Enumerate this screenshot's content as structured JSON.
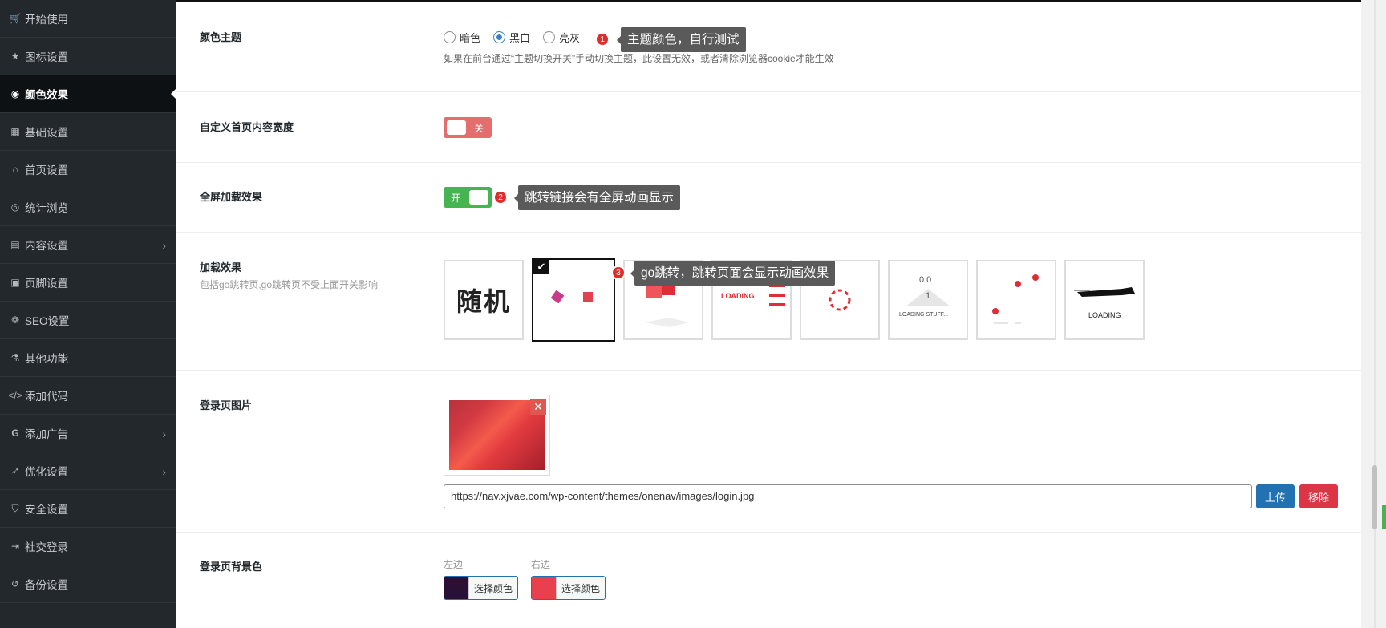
{
  "sidebar": {
    "items": [
      {
        "label": "开始使用",
        "icon": "cart-icon"
      },
      {
        "label": "图标设置",
        "icon": "star-icon"
      },
      {
        "label": "颜色效果",
        "icon": "palette-icon",
        "active": true
      },
      {
        "label": "基础设置",
        "icon": "grid-icon"
      },
      {
        "label": "首页设置",
        "icon": "home-icon"
      },
      {
        "label": "统计浏览",
        "icon": "eye-icon"
      },
      {
        "label": "内容设置",
        "icon": "file-icon",
        "has_arrow": true
      },
      {
        "label": "页脚设置",
        "icon": "footer-icon"
      },
      {
        "label": "SEO设置",
        "icon": "paw-icon"
      },
      {
        "label": "其他功能",
        "icon": "flask-icon"
      },
      {
        "label": "添加代码",
        "icon": "code-icon"
      },
      {
        "label": "添加广告",
        "icon": "google-icon",
        "has_arrow": true
      },
      {
        "label": "优化设置",
        "icon": "rocket-icon",
        "has_arrow": true
      },
      {
        "label": "安全设置",
        "icon": "shield-icon"
      },
      {
        "label": "社交登录",
        "icon": "login-icon"
      },
      {
        "label": "备份设置",
        "icon": "undo-icon"
      }
    ]
  },
  "theme": {
    "label": "颜色主题",
    "options": [
      "暗色",
      "黑白",
      "亮灰"
    ],
    "selected": "黑白",
    "hint": "如果在前台通过“主题切换开关”手动切换主题，此设置无效，或者清除浏览器cookie才能生效",
    "badge": "1",
    "tip": "主题颜色，自行测试"
  },
  "custom_width": {
    "label": "自定义首页内容宽度",
    "toggle_text": "关",
    "state": "off"
  },
  "fullscreen_loading": {
    "label": "全屏加载效果",
    "toggle_text": "开",
    "state": "on",
    "badge": "2",
    "tip": "跳转链接会有全屏动画显示"
  },
  "loading_effect": {
    "label": "加载效果",
    "sub": "包括go跳转页,go跳转页不受上面开关影响",
    "random_text": "随机",
    "loading_text": "LOADING",
    "loading_stuff_text": "LOADING STUFF...",
    "loading_stuff_digits": "0 0",
    "loading_stuff_num": "1",
    "loading_plain_text": "LOADING",
    "selected_index": 1,
    "badge": "3",
    "tip": "go跳转，跳转页面会显示动画效果"
  },
  "login_image": {
    "label": "登录页图片",
    "url": "https://nav.xjvae.com/wp-content/themes/onenav/images/login.jpg",
    "upload_label": "上传",
    "remove_label": "移除",
    "close_symbol": "✕"
  },
  "login_bg": {
    "label": "登录页背景色",
    "left_label": "左边",
    "right_label": "右边",
    "left_color": "#2a1035",
    "right_color": "#e8404c",
    "picker_label": "选择颜色"
  },
  "icons": {
    "check": "✔",
    "arrow": "›"
  }
}
